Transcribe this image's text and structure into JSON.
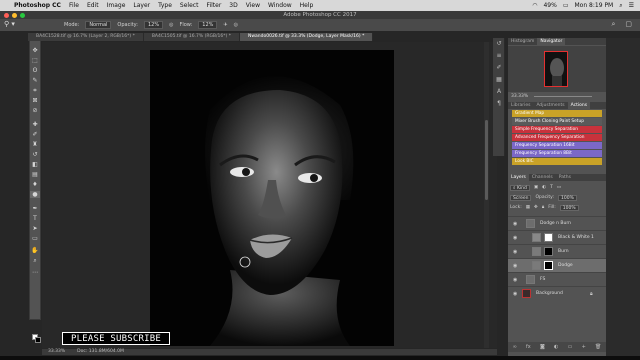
{
  "menubar": {
    "app_name": "Photoshop CC",
    "items": [
      "File",
      "Edit",
      "Image",
      "Layer",
      "Type",
      "Select",
      "Filter",
      "3D",
      "View",
      "Window",
      "Help"
    ],
    "battery": "49%",
    "clock": "Mon 8:19 PM"
  },
  "window_title": "Adobe Photoshop CC 2017",
  "options": {
    "mode_label": "Mode:",
    "mode_value": "Normal",
    "opacity_label": "Opacity:",
    "opacity_value": "12%",
    "flow_label": "Flow:",
    "flow_value": "12%"
  },
  "tabs": [
    "BA4C1528.tif @ 16.7% (Layer 2, RGB/16*) *",
    "BA4C1505.tif @ 16.7% (RGB/16*) *",
    "Nwando0026.tif @ 33.3% (Dodge, Layer Mask/16) *"
  ],
  "overlay_text": "PLEASE SUBSCRIBE",
  "status": {
    "zoom": "33.33%",
    "doc": "Doc: 131.8M/604.0M"
  },
  "panels": {
    "top_tabs": [
      "Histogram",
      "Navigator"
    ],
    "nav_zoom": "33.33%",
    "mid_tabs": [
      "Libraries",
      "Adjustments",
      "Actions"
    ],
    "actions": [
      {
        "label": "Gradient Map",
        "color": "#c9a227"
      },
      {
        "label": "Mixer Brush Cloning Paint Setup",
        "color": "#5a5a5a"
      },
      {
        "label": "Simple Frequency Separation",
        "color": "#c8323c"
      },
      {
        "label": "Advanced Frequency Separation",
        "color": "#c8323c"
      },
      {
        "label": "Frequency Separation 16Bit",
        "color": "#7b68c8"
      },
      {
        "label": "Frequency Separation 8Bit",
        "color": "#7b68c8"
      },
      {
        "label": "Look BIC",
        "color": "#c9a227"
      }
    ],
    "layer_tabs": [
      "Layers",
      "Channels",
      "Paths"
    ],
    "kind_label": "Kind",
    "blend_mode": "Screen",
    "opacity_label": "Opacity:",
    "opacity_value": "100%",
    "lock_label": "Lock:",
    "fill_label": "Fill:",
    "fill_value": "100%",
    "layers": [
      {
        "name": "Dodge n Burn"
      },
      {
        "name": "Black & White 1"
      },
      {
        "name": "Burn"
      },
      {
        "name": "Dodge"
      },
      {
        "name": "FS"
      },
      {
        "name": "Background"
      }
    ]
  }
}
